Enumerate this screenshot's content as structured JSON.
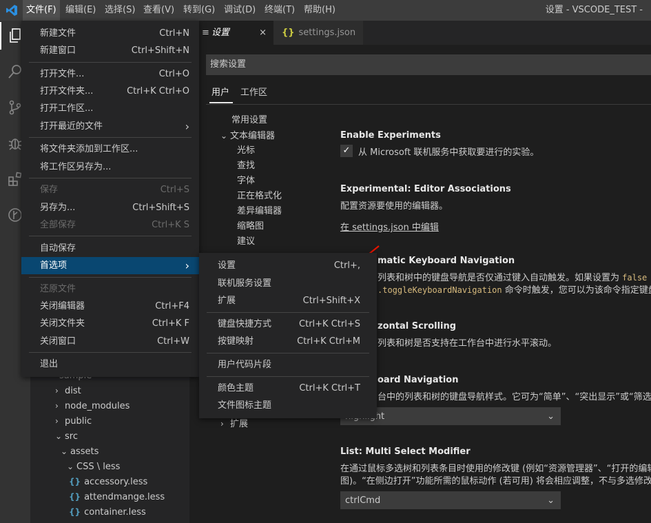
{
  "menubar": {
    "items": [
      "文件(F)",
      "编辑(E)",
      "选择(S)",
      "查看(V)",
      "转到(G)",
      "调试(D)",
      "终端(T)",
      "帮助(H)"
    ],
    "window_title": "设置 - VSCODE_TEST -"
  },
  "tabs": {
    "settings": "设置",
    "settings_close": "×",
    "json": "settings.json",
    "json_icon": "{}"
  },
  "settings": {
    "search_placeholder": "搜索设置",
    "scope_user": "用户",
    "scope_workspace": "工作区",
    "toc": [
      "常用设置",
      "文本编辑器",
      "光标",
      "查找",
      "字体",
      "正在格式化",
      "差异编辑器",
      "缩略图",
      "建议",
      "扩展"
    ],
    "enable_experiments": {
      "title": "Enable Experiments",
      "desc": "从 Microsoft 联机服务中获取要进行的实验。"
    },
    "editor_assoc": {
      "title_prefix": "Experimental: ",
      "title": "Editor Associations",
      "desc": "配置资源要使用的编辑器。",
      "link": "在 settings.json 中编辑"
    },
    "auto_nav": {
      "title": "matic Keyboard Navigation",
      "desc1": "列表和树中的键盘导航是否仅通过键入自动触发。如果设置为",
      "code1": "false",
      "code2": ".toggleKeyboardNavigation",
      "desc2": "命令时触发，您可以为该命令指定键盘"
    },
    "horiz": {
      "title": "zontal Scrolling",
      "desc": "列表和树是否支持在工作台中进行水平滚动。"
    },
    "kb_nav": {
      "title": "oard Navigation",
      "desc": "台中的列表和树的键盘导航样式。它可为“简单”、“突出显示”或“筛选”。",
      "value": "highlight"
    },
    "multi_select": {
      "title_prefix": "List: ",
      "title": "Multi Select Modifier",
      "desc1": "在通过鼠标多选树和列表条目时使用的修改键 (例如“资源管理器”、“打开的编辑",
      "desc2": "图)。“在侧边打开”功能所需的鼠标动作 (若可用) 将会相应调整，不与多选修改键",
      "value": "ctrlCmd"
    }
  },
  "explorer": {
    "partial": "sample",
    "items": [
      {
        "label": "dist",
        "kind": "folder-closed"
      },
      {
        "label": "node_modules",
        "kind": "folder-closed"
      },
      {
        "label": "public",
        "kind": "folder-closed"
      },
      {
        "label": "src",
        "kind": "folder-open"
      },
      {
        "label": "assets",
        "kind": "folder-open"
      },
      {
        "label": "CSS \\ less",
        "kind": "folder-open"
      },
      {
        "label": "accessory.less",
        "kind": "file"
      },
      {
        "label": "attendmange.less",
        "kind": "file"
      },
      {
        "label": "container.less",
        "kind": "file"
      }
    ]
  },
  "file_menu": {
    "new_file": {
      "label": "新建文件",
      "key": "Ctrl+N"
    },
    "new_window": {
      "label": "新建窗口",
      "key": "Ctrl+Shift+N"
    },
    "open_file": {
      "label": "打开文件...",
      "key": "Ctrl+O"
    },
    "open_folder": {
      "label": "打开文件夹...",
      "key": "Ctrl+K Ctrl+O"
    },
    "open_workspace": {
      "label": "打开工作区..."
    },
    "open_recent": {
      "label": "打开最近的文件",
      "arrow": "›"
    },
    "add_folder": {
      "label": "将文件夹添加到工作区..."
    },
    "save_workspace_as": {
      "label": "将工作区另存为..."
    },
    "save": {
      "label": "保存",
      "key": "Ctrl+S"
    },
    "save_as": {
      "label": "另存为...",
      "key": "Ctrl+Shift+S"
    },
    "save_all": {
      "label": "全部保存",
      "key": "Ctrl+K S"
    },
    "auto_save": {
      "label": "自动保存"
    },
    "preferences": {
      "label": "首选项",
      "arrow": "›"
    },
    "revert": {
      "label": "还原文件"
    },
    "close_editor": {
      "label": "关闭编辑器",
      "key": "Ctrl+F4"
    },
    "close_folder": {
      "label": "关闭文件夹",
      "key": "Ctrl+K F"
    },
    "close_window": {
      "label": "关闭窗口",
      "key": "Ctrl+W"
    },
    "exit": {
      "label": "退出"
    }
  },
  "pref_menu": {
    "settings": {
      "label": "设置",
      "key": "Ctrl+,"
    },
    "online_services": {
      "label": "联机服务设置"
    },
    "extensions": {
      "label": "扩展",
      "key": "Ctrl+Shift+X"
    },
    "keyboard_shortcuts": {
      "label": "键盘快捷方式",
      "key": "Ctrl+K Ctrl+S"
    },
    "keymaps": {
      "label": "按键映射",
      "key": "Ctrl+K Ctrl+M"
    },
    "user_snippets": {
      "label": "用户代码片段"
    },
    "color_theme": {
      "label": "颜色主题",
      "key": "Ctrl+K Ctrl+T"
    },
    "file_icon_theme": {
      "label": "文件图标主题"
    }
  },
  "colors": {
    "accent": "#007acc",
    "menu_selected": "#094771",
    "annotation_arrow": "#e51400"
  }
}
